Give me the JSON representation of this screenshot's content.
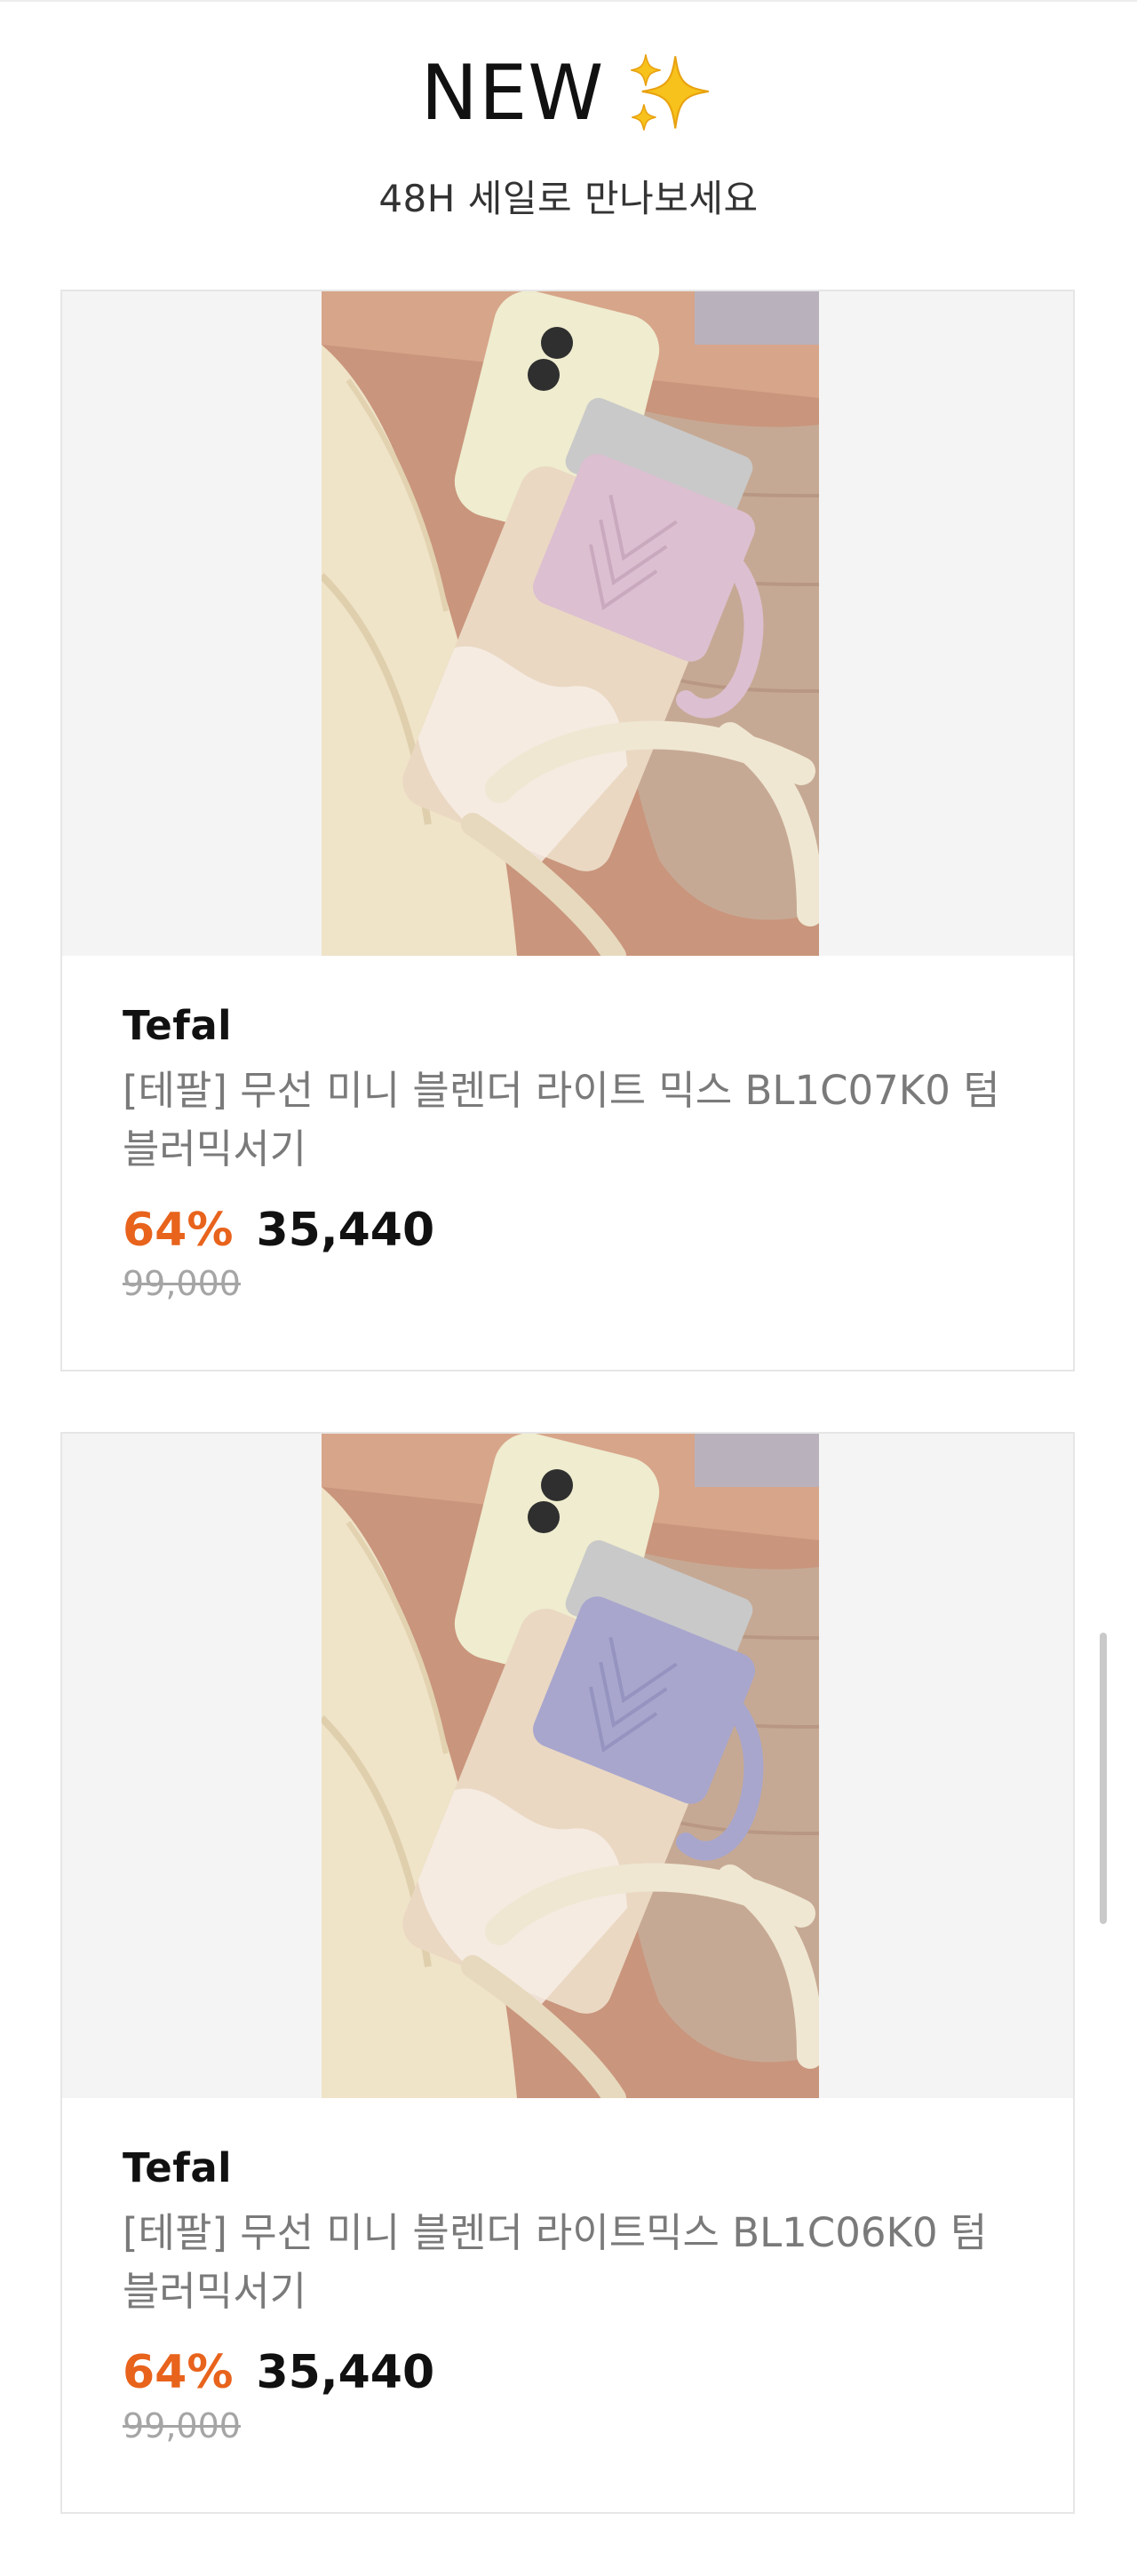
{
  "header": {
    "title": "NEW",
    "title_icon": "sparkles-icon",
    "subtitle": "48H 세일로 만나보세요"
  },
  "products": [
    {
      "brand": "Tefal",
      "name": "[테팔] 무선 미니 블렌더 라이트 믹스 BL1C07K0 텀블러믹서기",
      "discount": "64%",
      "price": "35,440",
      "original_price": "99,000",
      "sleeve_color": "#dcbfd0"
    },
    {
      "brand": "Tefal",
      "name": "[테팔] 무선 미니 블렌더 라이트믹스 BL1C06K0 텀블러믹서기",
      "discount": "64%",
      "price": "35,440",
      "original_price": "99,000",
      "sleeve_color": "#a8a6cd"
    }
  ],
  "colors": {
    "discount": "#e8631c",
    "original_price": "#a5a5a5",
    "name": "#7a7a7a",
    "card_border": "#e6e6e6",
    "image_background": "#f4f4f4"
  }
}
